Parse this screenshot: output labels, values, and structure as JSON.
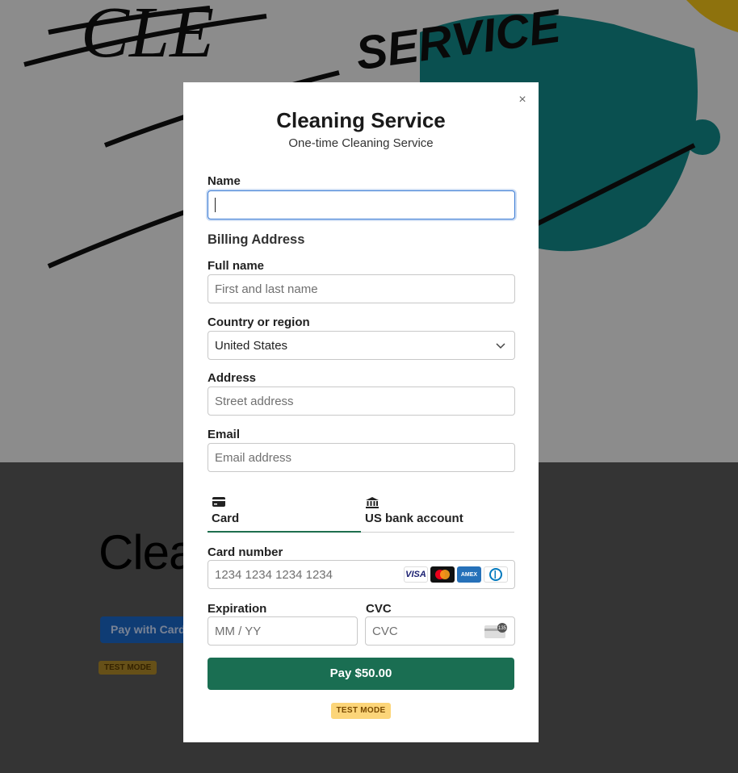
{
  "background": {
    "hero_logo_text": "SERVICE",
    "heading": "Clea",
    "pay_button_label": "Pay with Card",
    "test_mode_badge": "TEST MODE"
  },
  "modal": {
    "close_icon": "close-icon",
    "title": "Cleaning Service",
    "subtitle": "One-time Cleaning Service",
    "name_label": "Name",
    "name_value": "",
    "billing_title": "Billing Address",
    "full_name_label": "Full name",
    "full_name_placeholder": "First and last name",
    "country_label": "Country or region",
    "country_value": "United States",
    "address_label": "Address",
    "address_placeholder": "Street address",
    "email_label": "Email",
    "email_placeholder": "Email address",
    "tabs": [
      {
        "label": "Card",
        "icon": "card-icon",
        "selected": true
      },
      {
        "label": "US bank account",
        "icon": "bank-icon",
        "selected": false
      }
    ],
    "card_number_label": "Card number",
    "card_number_placeholder": "1234 1234 1234 1234",
    "card_brands": [
      "VISA",
      "mastercard",
      "AMEX",
      "diners"
    ],
    "expiration_label": "Expiration",
    "expiration_placeholder": "MM / YY",
    "cvc_label": "CVC",
    "cvc_placeholder": "CVC",
    "cvc_icon_text": "135",
    "pay_button": "Pay $50.00",
    "test_mode": "TEST MODE"
  },
  "colors": {
    "accent": "#1a6e52",
    "focus": "#3b7bd4",
    "test_badge": "#fcd579"
  }
}
